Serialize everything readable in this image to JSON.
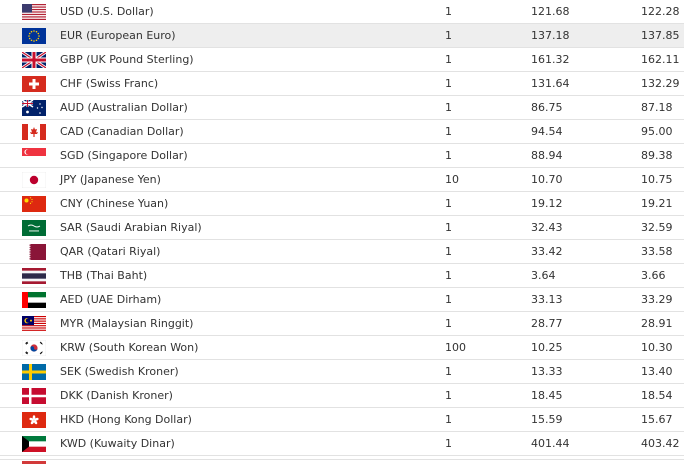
{
  "rates": [
    {
      "code_name": "USD (U.S. Dollar)",
      "unit": "1",
      "buy": "121.68",
      "sell": "122.28",
      "flag": "usa-flag-icon"
    },
    {
      "code_name": "EUR (European Euro)",
      "unit": "1",
      "buy": "137.18",
      "sell": "137.85",
      "flag": "eu-flag-icon"
    },
    {
      "code_name": "GBP (UK Pound Sterling)",
      "unit": "1",
      "buy": "161.32",
      "sell": "162.11",
      "flag": "uk-flag-icon"
    },
    {
      "code_name": "CHF (Swiss Franc)",
      "unit": "1",
      "buy": "131.64",
      "sell": "132.29",
      "flag": "swiss-flag-icon"
    },
    {
      "code_name": "AUD (Australian Dollar)",
      "unit": "1",
      "buy": "86.75",
      "sell": "87.18",
      "flag": "australia-flag-icon"
    },
    {
      "code_name": "CAD (Canadian Dollar)",
      "unit": "1",
      "buy": "94.54",
      "sell": "95.00",
      "flag": "canada-flag-icon"
    },
    {
      "code_name": "SGD (Singapore Dollar)",
      "unit": "1",
      "buy": "88.94",
      "sell": "89.38",
      "flag": "singapore-flag-icon"
    },
    {
      "code_name": "JPY (Japanese Yen)",
      "unit": "10",
      "buy": "10.70",
      "sell": "10.75",
      "flag": "japan-flag-icon"
    },
    {
      "code_name": "CNY (Chinese Yuan)",
      "unit": "1",
      "buy": "19.12",
      "sell": "19.21",
      "flag": "china-flag-icon"
    },
    {
      "code_name": "SAR (Saudi Arabian Riyal)",
      "unit": "1",
      "buy": "32.43",
      "sell": "32.59",
      "flag": "saudi-flag-icon"
    },
    {
      "code_name": "QAR (Qatari Riyal)",
      "unit": "1",
      "buy": "33.42",
      "sell": "33.58",
      "flag": "qatar-flag-icon"
    },
    {
      "code_name": "THB (Thai Baht)",
      "unit": "1",
      "buy": "3.64",
      "sell": "3.66",
      "flag": "thailand-flag-icon"
    },
    {
      "code_name": "AED (UAE Dirham)",
      "unit": "1",
      "buy": "33.13",
      "sell": "33.29",
      "flag": "uae-flag-icon"
    },
    {
      "code_name": "MYR (Malaysian Ringgit)",
      "unit": "1",
      "buy": "28.77",
      "sell": "28.91",
      "flag": "malaysia-flag-icon"
    },
    {
      "code_name": "KRW (South Korean Won)",
      "unit": "100",
      "buy": "10.25",
      "sell": "10.30",
      "flag": "south-korea-flag-icon"
    },
    {
      "code_name": "SEK (Swedish Kroner)",
      "unit": "1",
      "buy": "13.33",
      "sell": "13.40",
      "flag": "sweden-flag-icon"
    },
    {
      "code_name": "DKK (Danish Kroner)",
      "unit": "1",
      "buy": "18.45",
      "sell": "18.54",
      "flag": "denmark-flag-icon"
    },
    {
      "code_name": "HKD (Hong Kong Dollar)",
      "unit": "1",
      "buy": "15.59",
      "sell": "15.67",
      "flag": "hong-kong-flag-icon"
    },
    {
      "code_name": "KWD (Kuwaity Dinar)",
      "unit": "1",
      "buy": "401.44",
      "sell": "403.42",
      "flag": "kuwait-flag-icon"
    }
  ],
  "highlight_row": 1,
  "colors": {
    "row_highlight": "#eeeeee",
    "divider": "#e2e2e2",
    "text": "#333333"
  }
}
